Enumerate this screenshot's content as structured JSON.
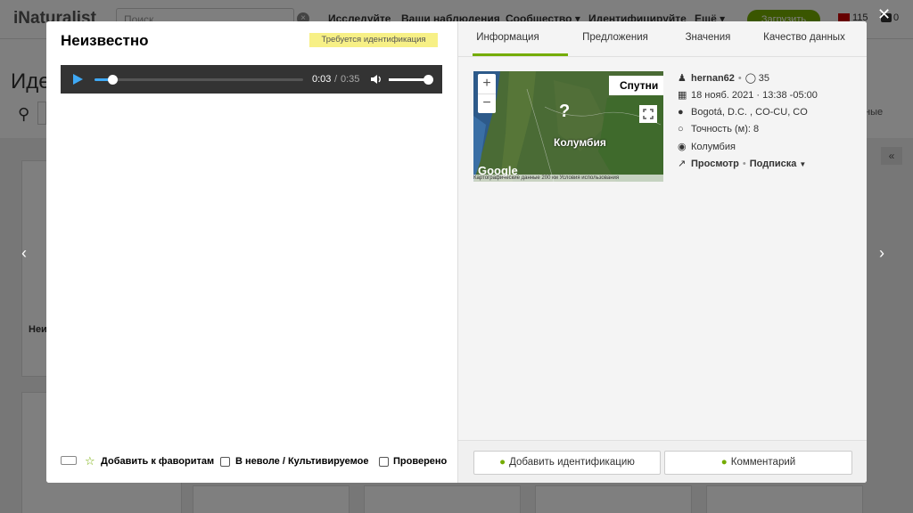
{
  "background": {
    "logo": "iNaturalist",
    "search_placeholder": "Поиск",
    "nav": [
      "Исследуйте",
      "Ваши наблюдения",
      "Сообщество ▾",
      "Идентифицируйте",
      "Ещё ▾"
    ],
    "upload_label": "Загрузить",
    "mail_count": "115",
    "comments_count": "0",
    "heading": "Иде",
    "right_text": "ные",
    "card_text": "Неи"
  },
  "modal": {
    "title": "Неизвестно",
    "badge": "Требуется идентификация",
    "audio": {
      "current_time": "0:03",
      "separator": "/",
      "duration": "0:35",
      "progress": 0.085,
      "volume": 1.0
    },
    "bottom": {
      "favorite_label": "Добавить к фаворитам",
      "captive_label": "В неволе / Культивируемое",
      "reviewed_label": "Проверено"
    },
    "tabs": [
      "Информация",
      "Предложения",
      "Значения",
      "Качество данных"
    ],
    "map": {
      "satellite_label": "Спутни",
      "country_label": "Колумбия",
      "google_label": "Google",
      "footer_text": "Картографические данные  200 км  Условия использования",
      "zoom_in": "+",
      "zoom_out": "−"
    },
    "details": {
      "user": "hernan62",
      "observations": "35",
      "date": "18 нояб. 2021 · 13:38 -05:00",
      "place": "Bogotá, D.C. , CO-CU, CO",
      "accuracy": "Точность (м): 8",
      "country": "Колумбия",
      "view_label": "Просмотр",
      "subscribe_label": "Подписка"
    },
    "actions": {
      "add_id": "Добавить идентификацию",
      "comment": "Комментарий"
    }
  },
  "colors": {
    "accent": "#74ac00",
    "badge_bg": "#f7f086",
    "player_bg": "#333333",
    "player_accent": "#3fa9f5"
  }
}
